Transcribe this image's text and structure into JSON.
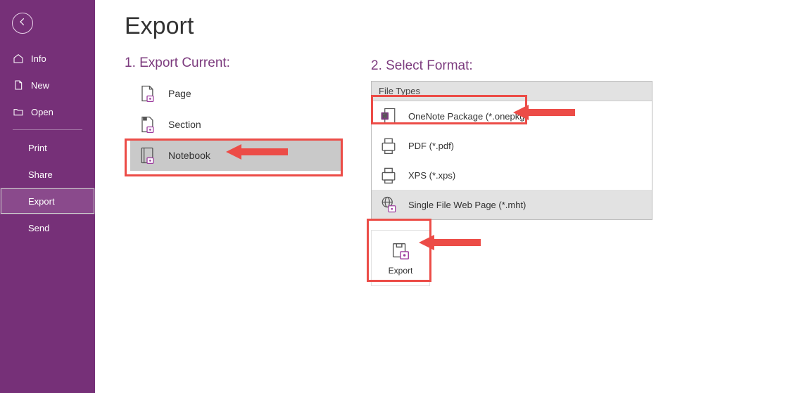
{
  "sidebar": {
    "info": "Info",
    "new": "New",
    "open": "Open",
    "print": "Print",
    "share": "Share",
    "export": "Export",
    "send": "Send"
  },
  "page": {
    "title": "Export"
  },
  "sectionA": {
    "heading": "1. Export Current:",
    "items": [
      {
        "label": "Page"
      },
      {
        "label": "Section"
      },
      {
        "label": "Notebook"
      }
    ]
  },
  "sectionB": {
    "heading": "2. Select Format:",
    "groupLabel": "File Types",
    "formats": [
      {
        "label": "OneNote Package (*.onepkg)"
      },
      {
        "label": "PDF (*.pdf)"
      },
      {
        "label": "XPS (*.xps)"
      },
      {
        "label": "Single File Web Page (*.mht)"
      }
    ]
  },
  "exportButton": {
    "label": "Export"
  }
}
